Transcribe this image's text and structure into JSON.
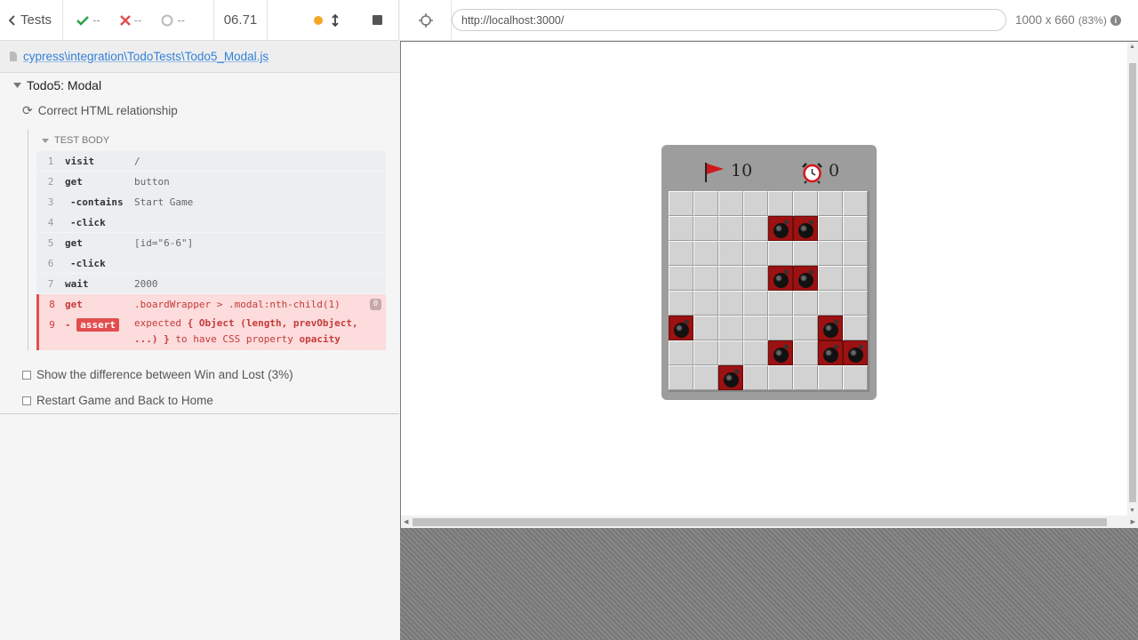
{
  "reporter": {
    "back_label": "Tests",
    "passed": "--",
    "failed": "--",
    "pending": "--",
    "duration": "06.71",
    "spec_path": "cypress\\integration\\TodoTests\\Todo5_Modal.js",
    "suite_title": "Todo5: Modal",
    "tests": [
      {
        "title": "Correct HTML relationship",
        "state": "running"
      },
      {
        "title": "Show the difference between Win and Lost (3%)",
        "state": "pending"
      },
      {
        "title": "Restart Game and Back to Home",
        "state": "pending"
      }
    ],
    "test_body_label": "TEST BODY",
    "commands": [
      {
        "num": "1",
        "name": "visit",
        "msg": "/"
      },
      {
        "num": "2",
        "name": "get",
        "msg": "button"
      },
      {
        "num": "3",
        "name": "-contains",
        "msg": "Start Game"
      },
      {
        "num": "4",
        "name": "-click",
        "msg": ""
      },
      {
        "num": "5",
        "name": "get",
        "msg": "[id=\"6-6\"]"
      },
      {
        "num": "6",
        "name": "-click",
        "msg": ""
      },
      {
        "num": "7",
        "name": "wait",
        "msg": "2000"
      },
      {
        "num": "8",
        "name": "get",
        "msg": ".boardWrapper > .modal:nth-child(1)",
        "badge": "0"
      },
      {
        "num": "9",
        "name": "assert",
        "prefix": "-",
        "msg_a": "expected ",
        "msg_b": "{ Object (length, prevObject,",
        "msg_c": "...) }",
        "msg_d": " to have CSS property ",
        "msg_e": "opacity"
      }
    ]
  },
  "aut": {
    "url": "http://localhost:3000/",
    "viewport": "1000 x 660",
    "scale": "(83%)",
    "game": {
      "flags": "10",
      "timer": "0",
      "mines": [
        [
          1,
          4
        ],
        [
          1,
          5
        ],
        [
          3,
          4
        ],
        [
          3,
          5
        ],
        [
          5,
          0
        ],
        [
          5,
          6
        ],
        [
          6,
          4
        ],
        [
          6,
          6
        ],
        [
          6,
          7
        ],
        [
          7,
          2
        ]
      ]
    }
  },
  "colors": {
    "accent": "#3380d6",
    "fail": "#e24e4e",
    "mine_bg": "#9c1111",
    "running_dot": "#f5a623"
  }
}
